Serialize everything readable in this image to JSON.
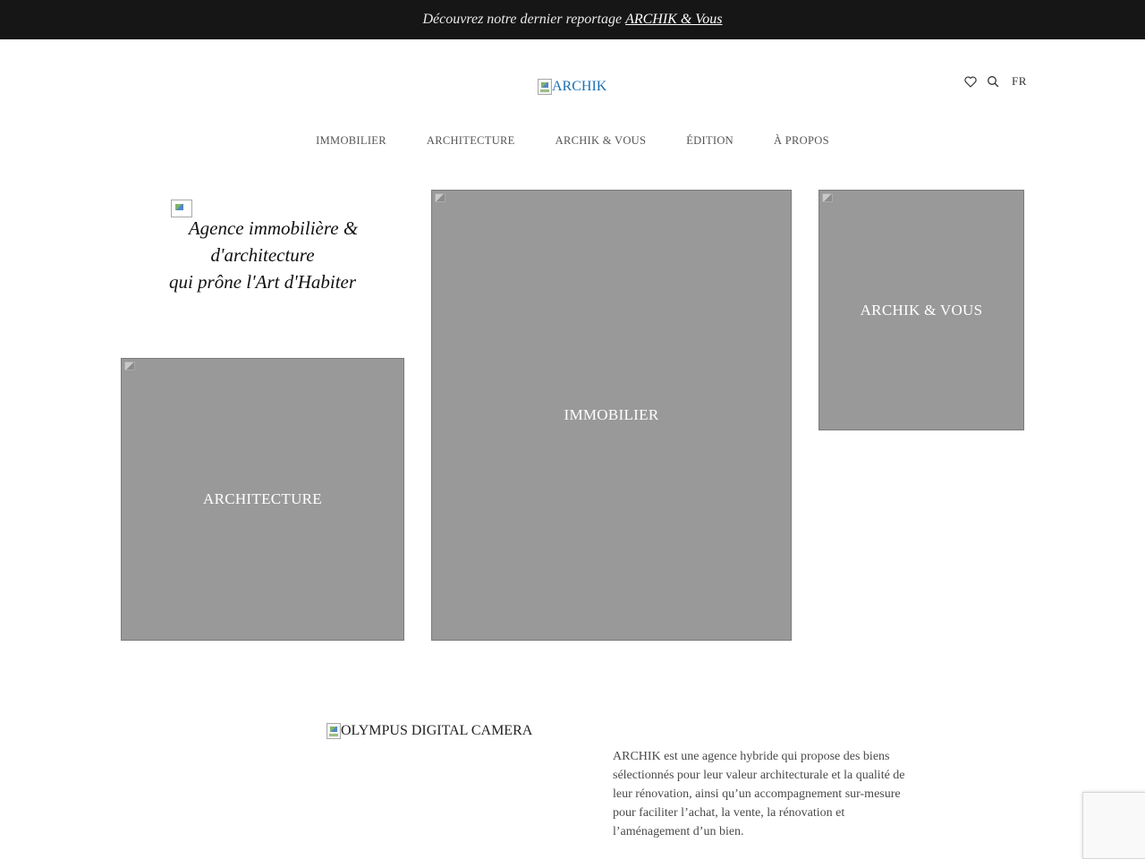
{
  "promo": {
    "text": "Découvrez notre dernier reportage",
    "link_label": "ARCHIK & Vous"
  },
  "header": {
    "logo_alt": "ARCHIK",
    "favorites_icon": "heart-icon",
    "search_icon": "search-icon",
    "language": "FR"
  },
  "nav": {
    "items": [
      {
        "label": "IMMOBILIER"
      },
      {
        "label": "ARCHITECTURE"
      },
      {
        "label": "ARCHIK & VOUS"
      },
      {
        "label": "ÉDITION"
      },
      {
        "label": "À PROPOS"
      }
    ]
  },
  "hero": {
    "tagline_line1": "Agence immobilière &",
    "tagline_line2": "d'architecture",
    "tagline_line3": "qui prône l'Art d'Habiter"
  },
  "tiles": {
    "architecture": "ARCHITECTURE",
    "immobilier": "IMMOBILIER",
    "archik_vous": "ARCHIK & VOUS"
  },
  "about": {
    "image_alt": "OLYMPUS DIGITAL CAMERA",
    "text": "ARCHIK est une agence hybride qui propose des biens sélectionnés pour leur valeur architecturale et la qualité de leur rénovation, ainsi qu’un accompagnement sur-mesure pour faciliter l’achat, la vente, la rénovation et l’aménagement d’un bien."
  },
  "colors": {
    "promo_bg": "#161616",
    "tile_placeholder": "#999999",
    "logo_link": "#1a6fb5"
  }
}
